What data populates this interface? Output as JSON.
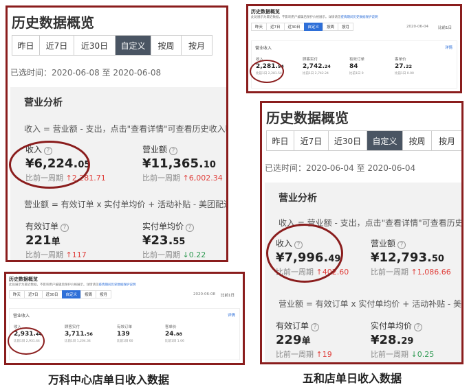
{
  "panel_wanke_detail": {
    "title": "历史数据概览",
    "tabs": [
      "昨日",
      "近7日",
      "近30日",
      "自定义",
      "按周",
      "按月"
    ],
    "active_tab": "自定义",
    "selected_range": "已选时间：2020-06-08 至 2020-06-08",
    "section_title": "营业分析",
    "formula_revenue": "收入 = 营业额 - 支出，点击\"查看详情\"可查看历史收入明细",
    "revenue_label": "收入",
    "revenue_int": "¥6,224.",
    "revenue_dec": "05",
    "revenue_cmp_label": "比前一周期",
    "revenue_cmp_value": "2,281.71",
    "turnover_label": "营业额",
    "turnover_int": "¥11,365.",
    "turnover_dec": "10",
    "turnover_cmp_label": "比前一周期",
    "turnover_cmp_value": "6,002.34",
    "formula_turnover": "营业额 = 有效订单 x 实付单均价 + 活动补贴 - 美团配送费",
    "orders_label": "有效订单",
    "orders_value": "221",
    "orders_unit": "单",
    "orders_cmp_label": "比前一周期",
    "orders_cmp_value": "117",
    "avg_label": "实付单均价",
    "avg_int": "¥23.",
    "avg_dec": "55",
    "avg_cmp_label": "比前一周期",
    "avg_cmp_value": "0.22"
  },
  "panel_wuhe_small": {
    "title": "历史数据概览",
    "note": "此处展示为最近数据，不影响用户编辑后保护价格展示。详情请见",
    "note_link": "疫情期间历史数据保护说明",
    "tabs": [
      "昨天",
      "近7日",
      "近30日",
      "自定义",
      "按周",
      "按月"
    ],
    "active_tab": "自定义",
    "date": "2020-06-04",
    "compare": "比前1日",
    "section_title": "营业收入",
    "detail_link": "详情",
    "metrics": [
      {
        "label": "收入",
        "int": "2,281.",
        "dec": "54",
        "cmp": "比前1日 2,281.54"
      },
      {
        "label": "顾客实付",
        "int": "2,742.",
        "dec": "24",
        "cmp": "比前1日 2,742.24"
      },
      {
        "label": "有效订单",
        "int": "84",
        "dec": "",
        "cmp": "比前1日 0"
      },
      {
        "label": "客单价",
        "int": "27.",
        "dec": "22",
        "cmp": "比前1日 0.00"
      }
    ]
  },
  "panel_wuhe_detail": {
    "title": "历史数据概览",
    "tabs": [
      "昨日",
      "近7日",
      "近30日",
      "自定义",
      "按周",
      "按月"
    ],
    "active_tab": "自定义",
    "selected_range": "已选时间：2020-06-04 至 2020-06-04",
    "section_title": "营业分析",
    "formula_revenue": "收入 = 营业额 - 支出，点击\"查看详情\"可查看历史收入明细",
    "revenue_label": "收入",
    "revenue_int": "¥7,996.",
    "revenue_dec": "49",
    "revenue_cmp_label": "比前一周期",
    "revenue_cmp_value": "402.60",
    "turnover_label": "营业额",
    "turnover_int": "¥12,793.",
    "turnover_dec": "50",
    "turnover_cmp_label": "比前一周期",
    "turnover_cmp_value": "1,086.66",
    "formula_turnover": "营业额 = 有效订单 x 实付单均价 + 活动补贴 - 美团配送费",
    "orders_label": "有效订单",
    "orders_value": "229",
    "orders_unit": "单",
    "orders_cmp_label": "比前一周期",
    "orders_cmp_value": "19",
    "avg_label": "实付单均价",
    "avg_int": "¥28.",
    "avg_dec": "29",
    "avg_cmp_label": "比前一周期",
    "avg_cmp_value": "0.25"
  },
  "panel_wanke_small": {
    "title": "历史数据概览",
    "note": "此处展示为最近数据，不影响用户编辑后保护价格展示。详情请见",
    "note_link": "疫情期间历史数据保护说明",
    "tabs": [
      "昨天",
      "近7日",
      "近30日",
      "自定义",
      "按周",
      "按月"
    ],
    "active_tab": "自定义",
    "date": "2020-06-08",
    "compare": "比前1日",
    "section_title": "营业收入",
    "detail_link": "详情",
    "metrics": [
      {
        "label": "收入",
        "int": "2,931.",
        "dec": "44",
        "cmp": "比前1日 2,931.44"
      },
      {
        "label": "顾客实付",
        "int": "3,711.",
        "dec": "56",
        "cmp": "比前1日 1,204.34"
      },
      {
        "label": "有效订单",
        "int": "139",
        "dec": "",
        "cmp": "比前1日 60"
      },
      {
        "label": "客单价",
        "int": "24.",
        "dec": "88",
        "cmp": "比前1日 1.06"
      }
    ]
  },
  "captions": {
    "left": "万科中心店单日收入数据",
    "right": "五和店单日收入数据"
  },
  "colors": {
    "annotation": "#8a1d1d",
    "active_tab": "#4a5563",
    "active_tab_small": "#2e6fd8",
    "increase": "#e0403c",
    "decrease": "#2e9a52"
  }
}
